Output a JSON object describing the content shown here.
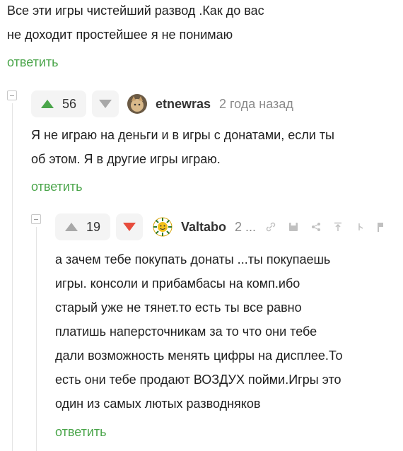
{
  "top_comment": {
    "lines": [
      "Все эти игры чистейший развод .Как до вас",
      "не доходит простейшее я не понимаю"
    ],
    "reply": "ответить"
  },
  "comment1": {
    "votes": "56",
    "username": "etnewras",
    "timestamp": "2 года назад",
    "lines": [
      "Я не играю на деньги и в игры с донатами, если ты",
      "об этом. Я в другие игры играю."
    ],
    "reply": "ответить"
  },
  "comment2": {
    "votes": "19",
    "username": "Valtabo",
    "timestamp": "2 ...",
    "lines": [
      "а зачем тебе покупать донаты ...ты покупаешь",
      "игры. консоли и прибамбасы на комп.ибо",
      "старый уже не тянет.то есть ты все равно",
      "платишь наперсточникам за то что они тебе",
      "дали возможность менять цифры на дисплее.То",
      "есть они тебе продают ВОЗДУХ пойми.Игры это",
      "один из самых лютых разводняков"
    ],
    "reply": "ответить"
  },
  "colors": {
    "accent": "#4aa54a",
    "downvote_active": "#e74c3c"
  },
  "icons": [
    "upvote-icon",
    "downvote-icon",
    "link-icon",
    "save-icon",
    "share-icon",
    "pin-icon",
    "hide-icon",
    "flag-icon"
  ]
}
